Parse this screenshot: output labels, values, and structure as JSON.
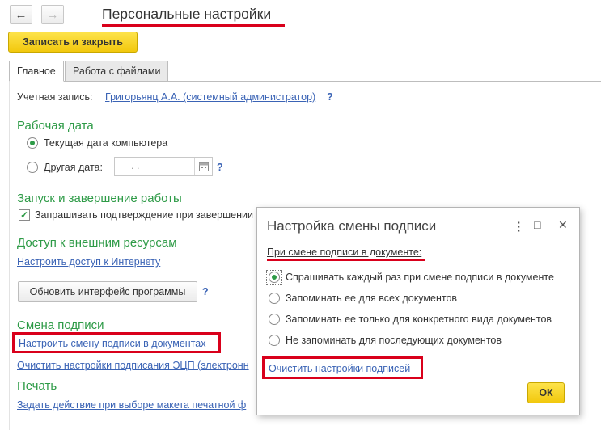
{
  "window": {
    "title": "Персональные настройки",
    "back_glyph": "←",
    "forward_glyph": "→"
  },
  "toolbar": {
    "save_close_label": "Записать и закрыть"
  },
  "tabs": [
    {
      "label": "Главное",
      "active": true
    },
    {
      "label": "Работа с файлами",
      "active": false
    }
  ],
  "main": {
    "account_label": "Учетная запись:",
    "account_value": "Григорьянц А.А. (системный администратор)",
    "help": "?",
    "work_date": {
      "heading": "Рабочая дата",
      "option_current": "Текущая дата компьютера",
      "option_other": "Другая дата:",
      "date_placeholder": ". .",
      "selected": "current"
    },
    "startup": {
      "heading": "Запуск и завершение работы",
      "confirm_exit_label": "Запрашивать подтверждение при завершении",
      "confirm_exit_checked": true
    },
    "external": {
      "heading": "Доступ к внешним ресурсам",
      "internet_link": "Настроить доступ к Интернету"
    },
    "update_button": "Обновить интерфейс программы",
    "signature": {
      "heading": "Смена подписи",
      "configure_link": "Настроить смену подписи в документах",
      "clear_ecp_link": "Очистить настройки подписания ЭЦП (электронн"
    },
    "print": {
      "heading": "Печать",
      "action_link": "Задать действие при выборе макета печатной ф"
    }
  },
  "dialog": {
    "title": "Настройка смены подписи",
    "menu_glyph": "⋮",
    "maximize_glyph": "□",
    "close_glyph": "✕",
    "prompt": "При смене подписи в документе:",
    "options": [
      {
        "label": "Спрашивать каждый раз при смене подписи в документе",
        "selected": true
      },
      {
        "label": "Запоминать ее для всех документов",
        "selected": false
      },
      {
        "label": "Запоминать ее только для конкретного вида документов",
        "selected": false
      },
      {
        "label": "Не запоминать для последующих документов",
        "selected": false
      }
    ],
    "clear_link": "Очистить настройки подписей",
    "ok_label": "ОК"
  },
  "colors": {
    "accent_green": "#2e9b47",
    "link_blue": "#3a63b5",
    "highlight_red": "#d9001b",
    "button_yellow": "#f2c80d"
  }
}
